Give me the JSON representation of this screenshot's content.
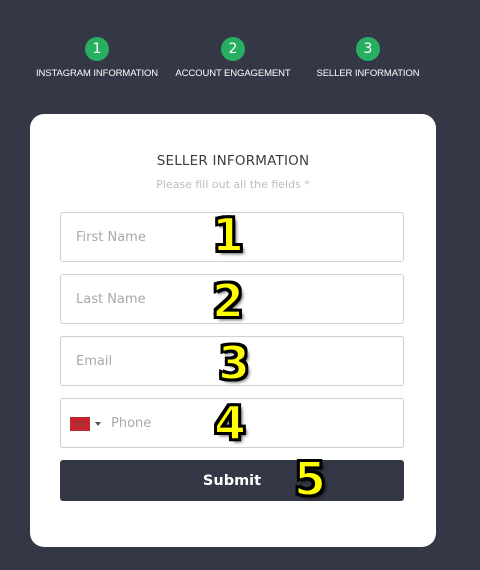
{
  "stepper": {
    "steps": [
      {
        "number": "1",
        "label": "INSTAGRAM INFORMATION"
      },
      {
        "number": "2",
        "label": "ACCOUNT ENGAGEMENT"
      },
      {
        "number": "3",
        "label": "SELLER INFORMATION"
      }
    ],
    "completed_color": "#27ae60"
  },
  "form": {
    "title": "SELLER INFORMATION",
    "subtitle": "Please fill out all the fields *",
    "fields": {
      "first_name": {
        "value": "",
        "placeholder": "First Name"
      },
      "last_name": {
        "value": "",
        "placeholder": "Last Name"
      },
      "email": {
        "value": "",
        "placeholder": "Email"
      },
      "phone": {
        "value": "",
        "placeholder": "Phone",
        "country_flag_icon": "morocco-flag-icon"
      }
    },
    "submit_label": "Submit"
  },
  "annotations": {
    "markers": [
      "1",
      "2",
      "3",
      "4",
      "5"
    ]
  },
  "colors": {
    "background": "#343746",
    "card": "#ffffff",
    "submit_button": "#343746",
    "marker": "#ffff00"
  }
}
